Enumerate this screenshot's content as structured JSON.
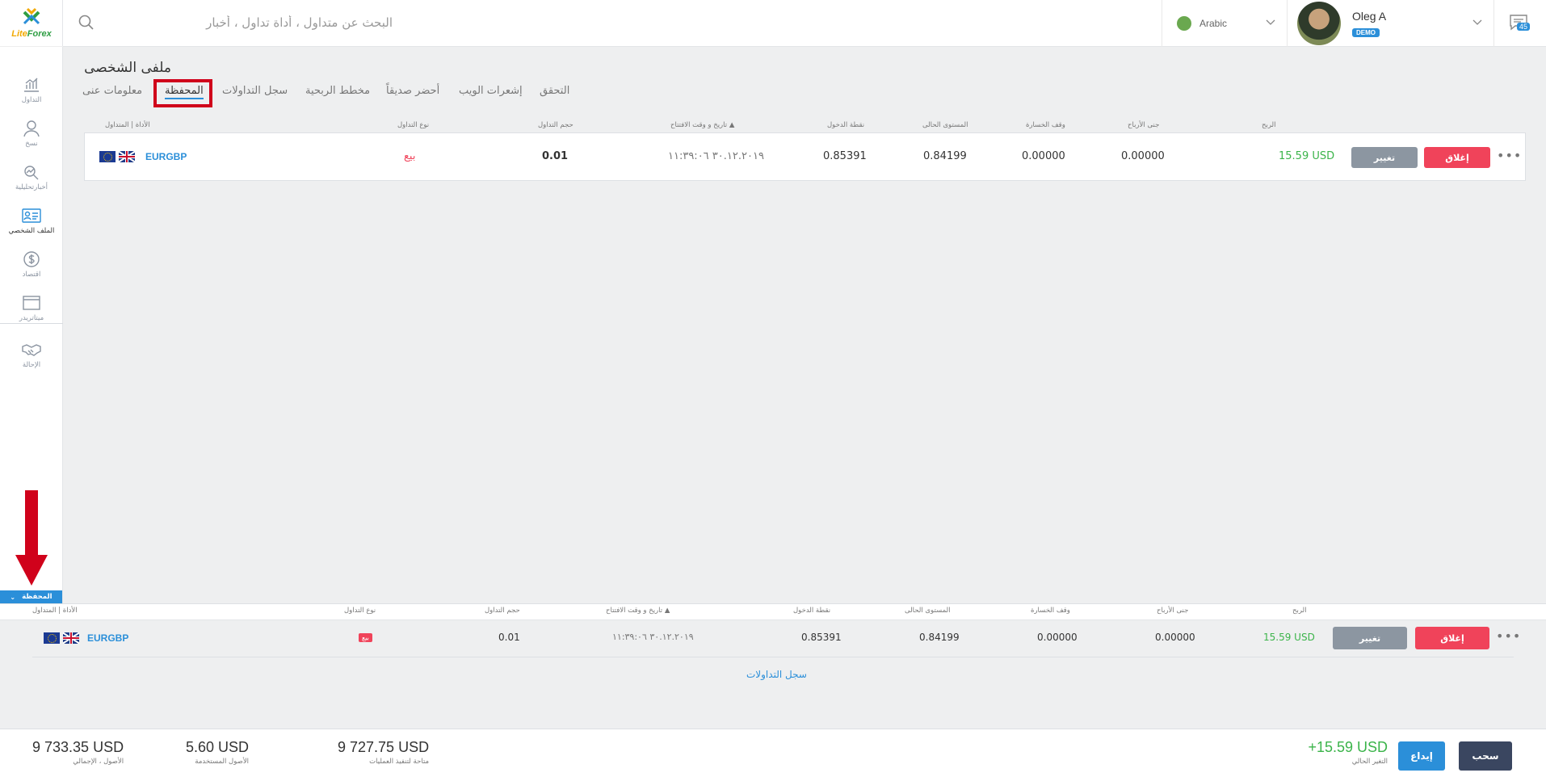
{
  "brand": {
    "logo_text_a": "Lite",
    "logo_text_b": "Forex",
    "green": "#2f9e44",
    "accent": "#2b8fd9",
    "danger": "#f0435a"
  },
  "sidebar": {
    "items": [
      {
        "label": "التداول",
        "icon": "chart-icon"
      },
      {
        "label": "نسخ",
        "icon": "person-icon"
      },
      {
        "label": "أخبارتحليلية",
        "icon": "analytics-icon"
      },
      {
        "label": "الملف الشخصي",
        "icon": "profile-card-icon"
      },
      {
        "label": "اقتصاد",
        "icon": "dollar-icon"
      },
      {
        "label": "ميتاتريدر",
        "icon": "window-icon"
      },
      {
        "label": "الإحالة",
        "icon": "handshake-icon"
      }
    ]
  },
  "header": {
    "search_placeholder": "البحث عن متداول ، أداة تداول ، أخبار",
    "language": "Arabic",
    "user_name": "Oleg A",
    "account_type": "DEMO",
    "messages_count": "45"
  },
  "page": {
    "title": "ملفى الشخصى",
    "tabs": [
      {
        "label": "التحقق"
      },
      {
        "label": "إشعرات الويب"
      },
      {
        "label": "أحضر صديقاً"
      },
      {
        "label": "مخطط الربحية"
      },
      {
        "label": "سجل التداولات"
      },
      {
        "label": "المحفظة"
      },
      {
        "label": "معلومات عنى"
      }
    ]
  },
  "table": {
    "headers": {
      "instrument": "الأداة | المتداول",
      "type": "نوع التداول",
      "volume": "حجم التداول",
      "open_time": "تاريخ و وقت الافتتاح",
      "entry": "نقطة الدخول",
      "current": "المستوى الحالى",
      "stop_loss": "وقف الخسارة",
      "take_profit": "جنى الأرباح",
      "profit": "الربح"
    },
    "sort_marker": "▲",
    "rows": [
      {
        "symbol": "EURGBP",
        "type": "بيع",
        "volume": "0.01",
        "open_time": "٣٠.١٢.٢٠١٩ ١١:٣٩:٠٦",
        "entry": "0.85391",
        "current": "0.84199",
        "stop_loss": "0.00000",
        "take_profit": "0.00000",
        "profit": "15.59 USD"
      }
    ],
    "btn_change": "تغيير",
    "btn_close": "إغلاق",
    "more": "•••"
  },
  "bottom_panel": {
    "tab_label": "المحفظة",
    "history_link": "سجل التداولات"
  },
  "footer": {
    "total_assets": {
      "value": "9 733.35 USD",
      "label": "الأصول ، الإجمالي"
    },
    "used_assets": {
      "value": "5.60 USD",
      "label": "الأصول المستخدمة"
    },
    "available": {
      "value": "9 727.75 USD",
      "label": "متاحة لتنفيذ العمليات"
    },
    "current_change": {
      "value": "+15.59 USD",
      "label": "التغير الحالي"
    },
    "deposit": "إيداع",
    "withdraw": "سحب"
  }
}
